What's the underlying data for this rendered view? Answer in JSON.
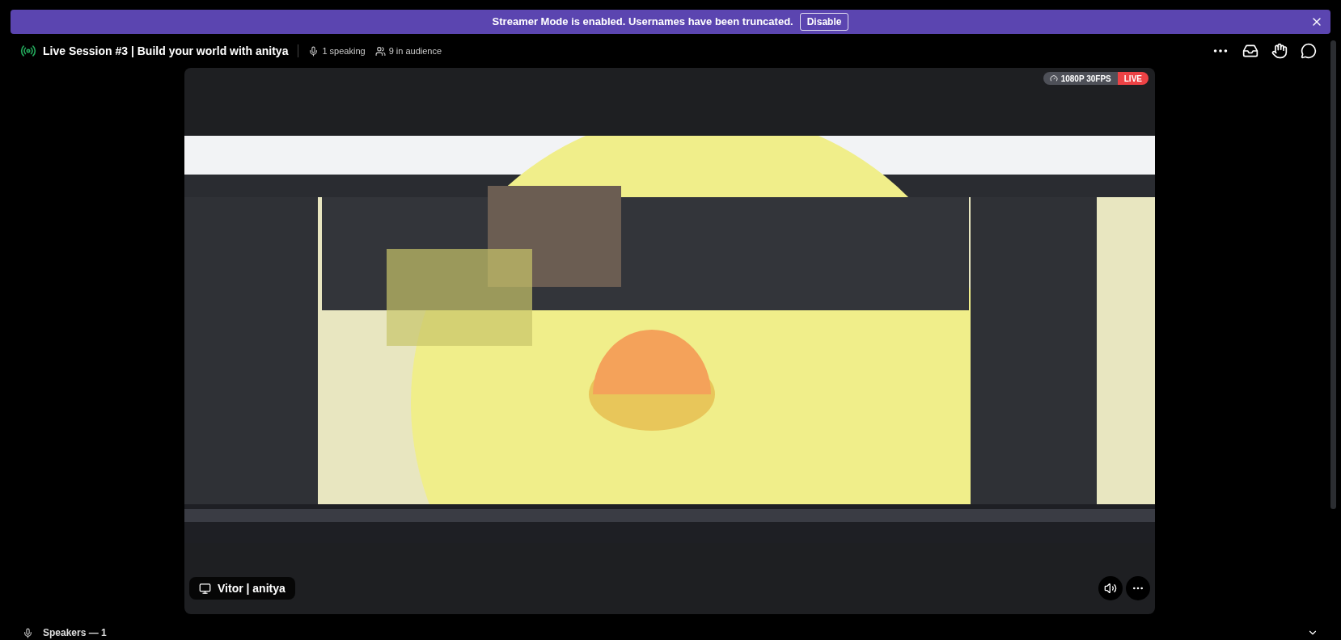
{
  "banner": {
    "message": "Streamer Mode is enabled. Usernames have been truncated.",
    "button": "Disable"
  },
  "header": {
    "title": "Live Session #3 | Build your world with anitya",
    "speaking": "1 speaking",
    "audience": "9 in audience"
  },
  "stream": {
    "quality": "1080P 30FPS",
    "live": "LIVE",
    "streamer": "Vitor | anitya"
  },
  "speakers": {
    "heading": "Speakers — 1"
  }
}
